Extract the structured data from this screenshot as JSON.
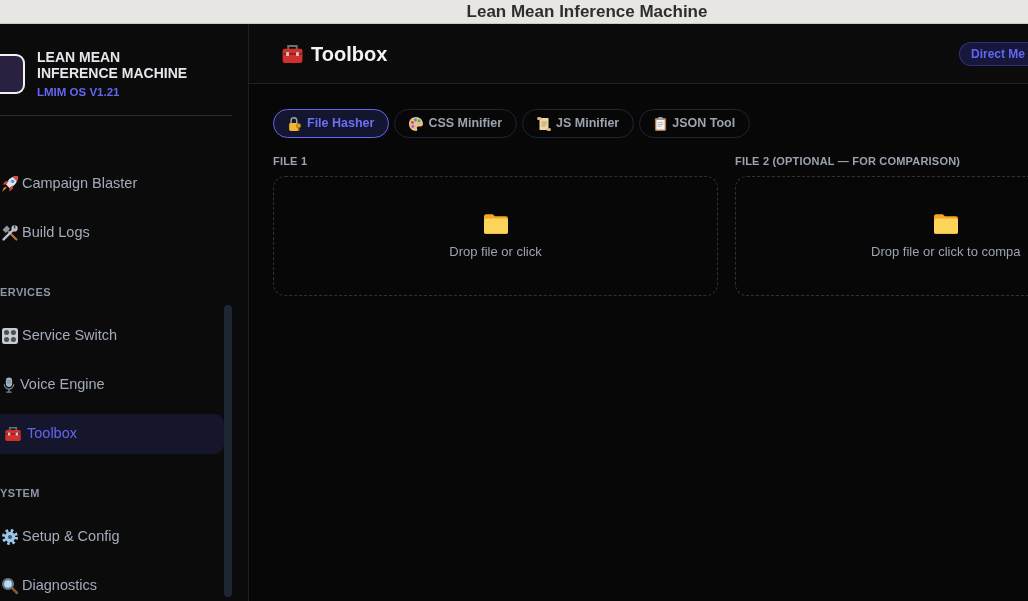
{
  "window": {
    "title": "Lean Mean Inference Machine"
  },
  "sidebar": {
    "brand": {
      "name": "LEAN MEAN INFERENCE MACHINE",
      "version": "LMIM OS V1.21"
    },
    "sections": [
      {
        "items": [
          {
            "label": "Campaign Blaster",
            "selected": false
          },
          {
            "label": "Build Logs",
            "selected": false
          }
        ]
      },
      {
        "heading": "ERVICES",
        "items": [
          {
            "label": "Service Switch",
            "selected": false
          },
          {
            "label": "Voice Engine",
            "selected": false
          },
          {
            "label": "Toolbox",
            "selected": true
          }
        ]
      },
      {
        "heading": "YSTEM",
        "items": [
          {
            "label": "Setup & Config",
            "selected": false
          },
          {
            "label": "Diagnostics",
            "selected": false
          }
        ]
      }
    ]
  },
  "header": {
    "title": "Toolbox",
    "button": "Direct Me"
  },
  "tabs": [
    {
      "label": "File Hasher",
      "selected": true
    },
    {
      "label": "CSS Minifier",
      "selected": false
    },
    {
      "label": "JS Minifier",
      "selected": false
    },
    {
      "label": "JSON Tool",
      "selected": false
    }
  ],
  "drop_zones": [
    {
      "label": "FILE 1",
      "hint": "Drop file or click"
    },
    {
      "label": "FILE 2 (OPTIONAL — FOR COMPARISON)",
      "hint": "Drop file or click to compa"
    }
  ]
}
